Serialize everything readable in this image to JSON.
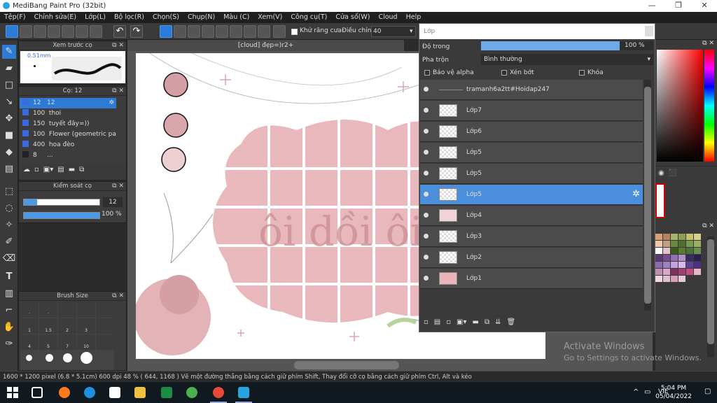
{
  "window": {
    "title": "MediBang Paint Pro (32bit)"
  },
  "menu": [
    "Tệp(F)",
    "Chỉnh sửa(E)",
    "Lớp(L)",
    "Bộ lọc(R)",
    "Chọn(S)",
    "Chụp(N)",
    "Màu (C)",
    "Xem(V)",
    "Công cụ(T)",
    "Cửa sổ(W)",
    "Cloud",
    "Help"
  ],
  "toolbar": {
    "antialias_label": "Khử răng cưa",
    "correction_label": "Điều chỉnh",
    "correction_value": "40"
  },
  "brush_preview": {
    "title": "Xem trước cọ",
    "size": "0.51mm"
  },
  "brush_panel": {
    "title": "Cọ: 12",
    "items": [
      {
        "size": "12",
        "name": "12",
        "color": "#3a6ae0"
      },
      {
        "size": "100",
        "name": "thoi",
        "color": "#3a6ae0"
      },
      {
        "size": "150",
        "name": "tuyết đây=))",
        "color": "#3a6ae0"
      },
      {
        "size": "100",
        "name": "Flower (geometric patt",
        "color": "#3a6ae0"
      },
      {
        "size": "400",
        "name": "hoa đèo",
        "color": "#3a6ae0"
      },
      {
        "size": "8",
        "name": "...",
        "color": "#222"
      }
    ]
  },
  "brush_control": {
    "title": "Kiểm soát cọ",
    "size_value": "12",
    "opacity_value": "100 %",
    "size_fraction": 0.18,
    "opacity_fraction": 1.0
  },
  "brush_size": {
    "title": "Brush Size",
    "labels": [
      ".",
      ".",
      "1",
      "1.5",
      "2",
      "3",
      "4",
      "5",
      "7",
      "10"
    ]
  },
  "canvas": {
    "tab_title": "[cloud] đẹp=)r2+",
    "lettering": "ôi dồi ôi",
    "watermark": "TRAMANH6A2TT#HOIDAP247"
  },
  "layers": {
    "window_title": "Lớp",
    "opacity_label": "Độ trong",
    "opacity_value": "100 %",
    "blend_label": "Pha trộn",
    "blend_value": "Bình thường",
    "protect_alpha": "Bảo vệ alpha",
    "clipping": "Xén bớt",
    "lock": "Khóa",
    "items": [
      {
        "name": "tramanh6a2tt#Hoidap247",
        "selected": false
      },
      {
        "name": "Lớp7",
        "selected": false
      },
      {
        "name": "Lớp6",
        "selected": false
      },
      {
        "name": "Lớp5",
        "selected": false
      },
      {
        "name": "Lớp5",
        "selected": false
      },
      {
        "name": "Lớp5",
        "selected": true
      },
      {
        "name": "Lớp4",
        "selected": false
      },
      {
        "name": "Lớp3",
        "selected": false
      },
      {
        "name": "Lớp2",
        "selected": false
      },
      {
        "name": "Lớp1",
        "selected": false
      }
    ]
  },
  "status": {
    "text": "1600 * 1200 pixel  (6.8 * 5.1cm)  600 dpi  48 %  ( 644, 1168 )  Vẽ một đường thẳng bằng cách giữ phím Shift, Thay đổi cỡ cọ bằng cách giữ phím Ctrl, Alt và kéo"
  },
  "watermark": {
    "line1": "Activate Windows",
    "line2": "Go to Settings to activate Windows."
  },
  "taskbar": {
    "lang": "VIE",
    "time": "5:04 PM",
    "date": "05/04/2022"
  },
  "colors": {
    "accent": "#2e7bd6",
    "selected_layer": "#4b8fdc",
    "pink": "#e8b4b8"
  }
}
